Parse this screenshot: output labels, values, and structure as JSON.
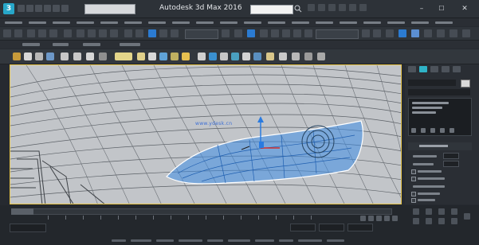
{
  "window": {
    "title": "Autodesk 3d Max 2016",
    "logo_icon": "3ds-max-logo-icon",
    "logo_glyph": "3",
    "workspace_label": "",
    "search_placeholder": "",
    "minimize_glyph": "–",
    "maximize_glyph": "☐",
    "close_glyph": "✕"
  },
  "viewport": {
    "watermark_text": "www.ydesk.cn",
    "selection_color": "#3f8ee6",
    "wireframe_color": "#555a60",
    "background_color": "#bfc2c6",
    "border_color": "#e8c64a"
  },
  "command_panel": {
    "object_name": "",
    "modifier_list_label": "",
    "stack_items": [
      "",
      "",
      ""
    ],
    "section_header": "",
    "swatch_color": "#d9d9d9"
  },
  "status": {
    "frame_counter": "",
    "prompt_text": ""
  },
  "colors": {
    "accent": "#2b7bd1",
    "app_logo": "#27a7c9",
    "command_tab_selected": "#2fb3c7"
  }
}
